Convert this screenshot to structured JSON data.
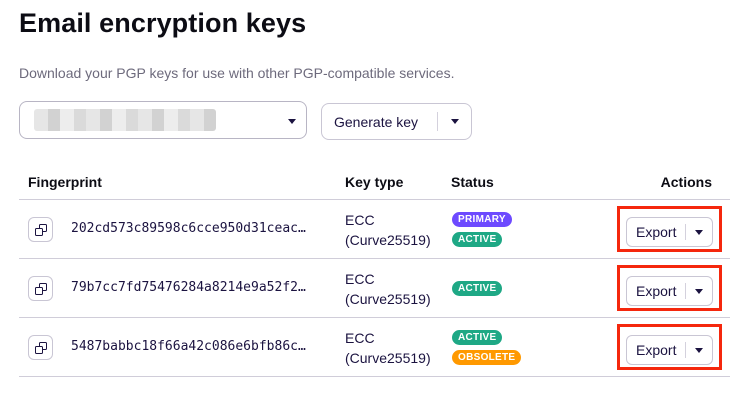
{
  "page": {
    "title": "Email encryption keys",
    "description": "Download your PGP keys for use with other PGP-compatible services."
  },
  "address_select": {
    "value": ""
  },
  "generate": {
    "label": "Generate key"
  },
  "table": {
    "headers": {
      "fingerprint": "Fingerprint",
      "key_type": "Key type",
      "status": "Status",
      "actions": "Actions"
    },
    "rows": [
      {
        "fingerprint": "202cd573c89598c6cce950d31ceac…",
        "key_type_line1": "ECC",
        "key_type_line2": "(Curve25519)",
        "badges": [
          {
            "label": "PRIMARY",
            "color": "#6d4aff"
          },
          {
            "label": "ACTIVE",
            "color": "#1ea885"
          }
        ],
        "export_label": "Export"
      },
      {
        "fingerprint": "79b7cc7fd75476284a8214e9a52f2…",
        "key_type_line1": "ECC",
        "key_type_line2": "(Curve25519)",
        "badges": [
          {
            "label": "ACTIVE",
            "color": "#1ea885"
          }
        ],
        "export_label": "Export"
      },
      {
        "fingerprint": "5487babbc18f66a42c086e6bfb86c…",
        "key_type_line1": "ECC",
        "key_type_line2": "(Curve25519)",
        "badges": [
          {
            "label": "ACTIVE",
            "color": "#1ea885"
          },
          {
            "label": "OBSOLETE",
            "color": "#ff9900"
          }
        ],
        "export_label": "Export"
      }
    ]
  },
  "colors": {
    "highlight": "#f5270d",
    "text": "#1b1340",
    "muted": "#6d6a7c"
  }
}
